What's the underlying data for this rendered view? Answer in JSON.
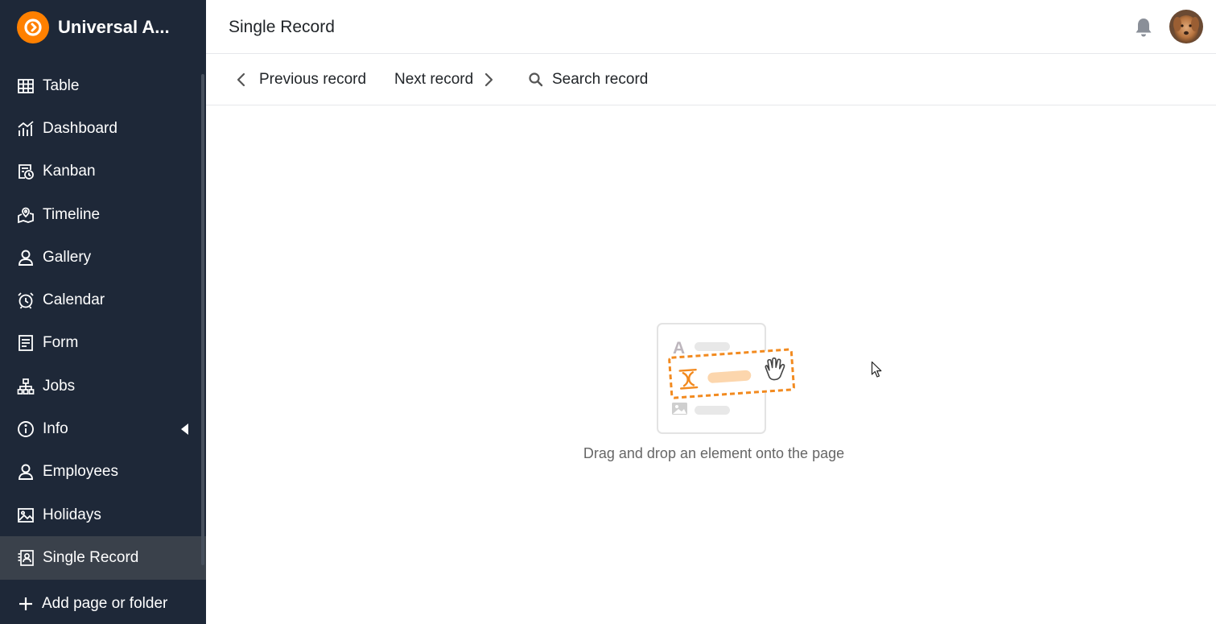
{
  "app": {
    "name": "Universal A...",
    "brand_color": "#ff8000",
    "sidebar_bg": "#1e2838"
  },
  "sidebar": {
    "items": [
      {
        "label": "Table",
        "icon": "table-icon"
      },
      {
        "label": "Dashboard",
        "icon": "dashboard-icon"
      },
      {
        "label": "Kanban",
        "icon": "kanban-icon"
      },
      {
        "label": "Timeline",
        "icon": "timeline-icon"
      },
      {
        "label": "Gallery",
        "icon": "gallery-icon"
      },
      {
        "label": "Calendar",
        "icon": "calendar-icon"
      },
      {
        "label": "Form",
        "icon": "form-icon"
      },
      {
        "label": "Jobs",
        "icon": "jobs-icon"
      },
      {
        "label": "Info",
        "icon": "info-icon"
      },
      {
        "label": "Employees",
        "icon": "employees-icon"
      },
      {
        "label": "Holidays",
        "icon": "holidays-icon"
      },
      {
        "label": "Single Record",
        "icon": "single-record-icon"
      }
    ],
    "active": "Single Record",
    "add_label": "Add page or folder"
  },
  "header": {
    "title": "Single Record"
  },
  "toolbar": {
    "prev_label": "Previous record",
    "next_label": "Next record",
    "search_label": "Search record"
  },
  "empty_state": {
    "text": "Drag and drop an element onto the page"
  }
}
